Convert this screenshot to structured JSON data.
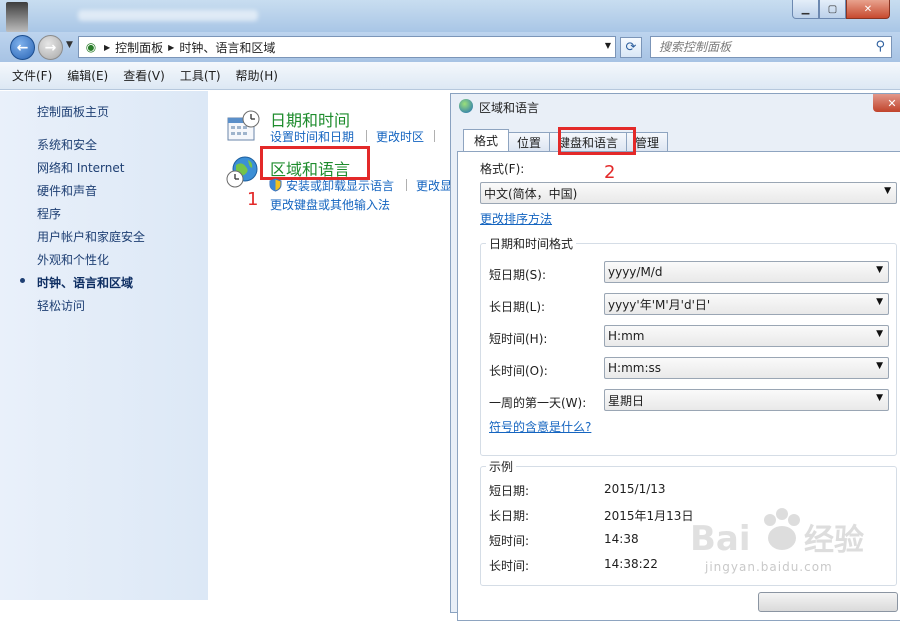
{
  "window": {
    "title_bar": {
      "buttons": [
        "minimize",
        "maximize",
        "close"
      ]
    },
    "address_bar": {
      "breadcrumbs": [
        "控制面板",
        "时钟、语言和区域"
      ],
      "search_placeholder": "搜索控制面板"
    },
    "menu": [
      "文件(F)",
      "编辑(E)",
      "查看(V)",
      "工具(T)",
      "帮助(H)"
    ]
  },
  "sidebar": {
    "items": [
      {
        "label": "控制面板主页",
        "active": false
      },
      {
        "label": "系统和安全",
        "active": false
      },
      {
        "label": "网络和 Internet",
        "active": false
      },
      {
        "label": "硬件和声音",
        "active": false
      },
      {
        "label": "程序",
        "active": false
      },
      {
        "label": "用户帐户和家庭安全",
        "active": false
      },
      {
        "label": "外观和个性化",
        "active": false
      },
      {
        "label": "时钟、语言和区域",
        "active": true
      },
      {
        "label": "轻松访问",
        "active": false
      }
    ]
  },
  "content": {
    "datetime": {
      "title": "日期和时间",
      "links": [
        "设置时间和日期",
        "更改时区"
      ]
    },
    "region": {
      "title": "区域和语言",
      "links": [
        "安装或卸载显示语言",
        "更改显",
        "更改键盘或其他输入法"
      ]
    },
    "annotations": [
      "1",
      "2"
    ]
  },
  "dialog": {
    "title": "区域和语言",
    "tabs": [
      "格式",
      "位置",
      "键盘和语言",
      "管理"
    ],
    "active_tab": "格式",
    "format_label": "格式(F):",
    "format_value": "中文(简体，中国)",
    "sort_link": "更改排序方法",
    "datetime_group": {
      "title": "日期和时间格式",
      "rows": [
        {
          "label": "短日期(S):",
          "value": "yyyy/M/d"
        },
        {
          "label": "长日期(L):",
          "value": "yyyy'年'M'月'd'日'"
        },
        {
          "label": "短时间(H):",
          "value": "H:mm"
        },
        {
          "label": "长时间(O):",
          "value": "H:mm:ss"
        },
        {
          "label": "一周的第一天(W):",
          "value": "星期日"
        }
      ],
      "help_link": "符号的含意是什么?"
    },
    "example_group": {
      "title": "示例",
      "rows": [
        {
          "label": "短日期:",
          "value": "2015/1/13"
        },
        {
          "label": "长日期:",
          "value": "2015年1月13日"
        },
        {
          "label": "短时间:",
          "value": "14:38"
        },
        {
          "label": "长时间:",
          "value": "14:38:22"
        }
      ]
    }
  },
  "watermark": {
    "url": "jingyan.baidu.com"
  },
  "colors": {
    "annotation_red": "#e32929",
    "link_blue": "#1565c0",
    "category_green": "#1e8c2d"
  }
}
